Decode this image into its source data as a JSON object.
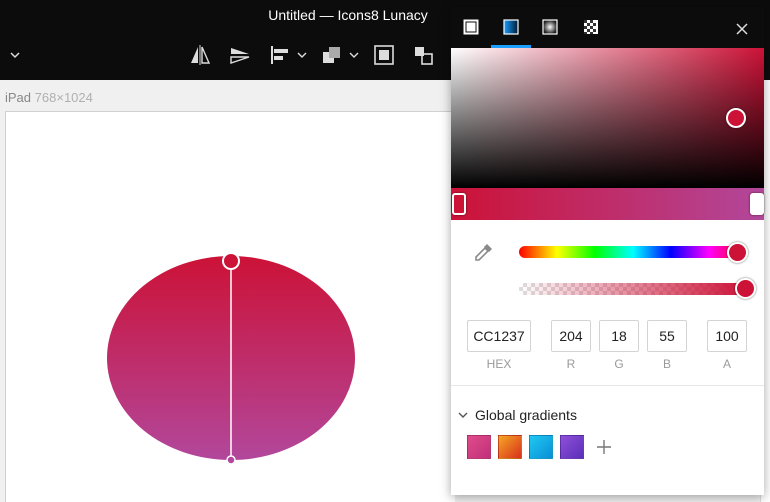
{
  "window": {
    "title": "Untitled — Icons8 Lunacy"
  },
  "toolbar": {
    "icons": [
      "chevron-down-icon",
      "flip-horizontal-icon",
      "flip-vertical-icon",
      "align-icon",
      "boolean-icon",
      "mask-icon",
      "group-icon"
    ]
  },
  "artboard": {
    "name": "iPad",
    "size": "768×1024"
  },
  "shape": {
    "fill_from": "#cc1237",
    "fill_to": "#b2479b"
  },
  "picker": {
    "tabs": [
      "solid-fill-icon",
      "linear-gradient-icon",
      "radial-gradient-icon",
      "pattern-icon"
    ],
    "active_tab": "linear-gradient-icon",
    "hex": "CC1237",
    "r": "204",
    "g": "18",
    "b": "55",
    "a": "100",
    "labels": {
      "hex": "HEX",
      "r": "R",
      "g": "G",
      "b": "B",
      "a": "A"
    },
    "hue_fraction": 0.96,
    "alpha_fraction": 1.0,
    "gradient_stops": [
      "#cc1237",
      "#b2479b"
    ]
  },
  "global_gradients": {
    "title": "Global gradients",
    "swatches": [
      {
        "from": "#e04c8a",
        "to": "#c0307a"
      },
      {
        "from": "#f5a623",
        "to": "#d8301c"
      },
      {
        "from": "#1fc8f0",
        "to": "#0a8fd8"
      },
      {
        "from": "#8f4fd8",
        "to": "#5a2fb8"
      }
    ]
  },
  "colors": {
    "accent": "#1a9fff",
    "titlebar": "#0c0c0c"
  }
}
